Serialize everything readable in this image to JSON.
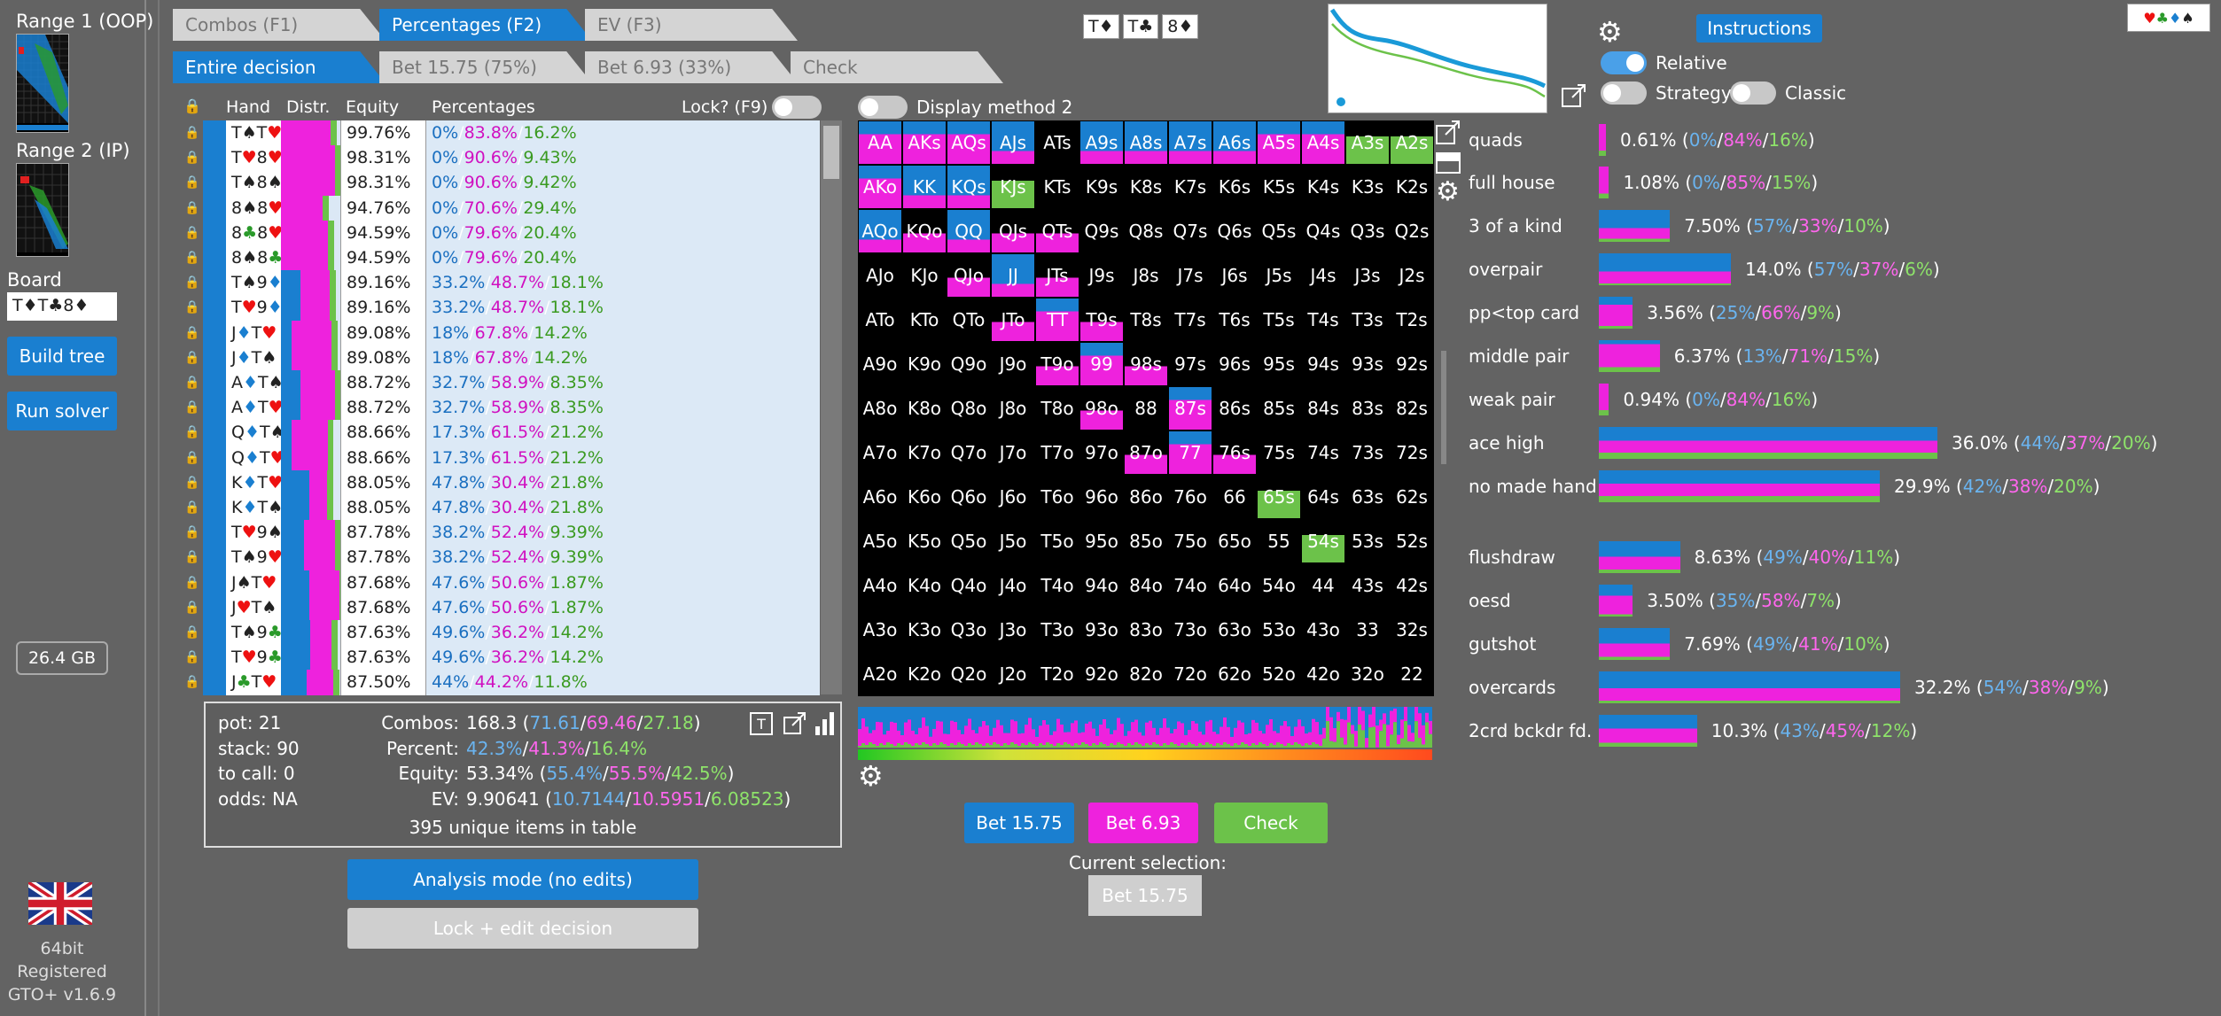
{
  "sidebar": {
    "range1_label": "Range 1 (OOP)",
    "range2_label": "Range 2 (IP)",
    "board_label": "Board",
    "board_value": "T♦T♣8♦",
    "build_tree": "Build tree",
    "run_solver": "Run solver",
    "memory": "26.4 GB",
    "bits": "64bit",
    "registered": "Registered",
    "version": "GTO+ v1.6.9"
  },
  "tabs_top": [
    "Combos (F1)",
    "Percentages (F2)",
    "EV (F3)"
  ],
  "tabs_decision": [
    "Entire decision",
    "Bet 15.75 (75%)",
    "Bet 6.93 (33%)",
    "Check"
  ],
  "board_cards": [
    "T♦",
    "T♣",
    "8♦"
  ],
  "table": {
    "headers": {
      "hand": "Hand",
      "distr": "Distr.",
      "equity": "Equity",
      "percentages": "Percentages",
      "lock": "Lock? (F9)"
    },
    "rows": [
      {
        "hand": "T♠T♥",
        "eq": "99.76%",
        "p": [
          "0%",
          "83.8%",
          "16.2%"
        ]
      },
      {
        "hand": "T♥8♥",
        "eq": "98.31%",
        "p": [
          "0%",
          "90.6%",
          "9.43%"
        ]
      },
      {
        "hand": "T♠8♠",
        "eq": "98.31%",
        "p": [
          "0%",
          "90.6%",
          "9.42%"
        ]
      },
      {
        "hand": "8♠8♥",
        "eq": "94.76%",
        "p": [
          "0%",
          "70.6%",
          "29.4%"
        ]
      },
      {
        "hand": "8♣8♥",
        "eq": "94.59%",
        "p": [
          "0%",
          "79.6%",
          "20.4%"
        ]
      },
      {
        "hand": "8♠8♣",
        "eq": "94.59%",
        "p": [
          "0%",
          "79.6%",
          "20.4%"
        ]
      },
      {
        "hand": "T♠9♦",
        "eq": "89.16%",
        "p": [
          "33.2%",
          "48.7%",
          "18.1%"
        ]
      },
      {
        "hand": "T♥9♦",
        "eq": "89.16%",
        "p": [
          "33.2%",
          "48.7%",
          "18.1%"
        ]
      },
      {
        "hand": "J♦T♥",
        "eq": "89.08%",
        "p": [
          "18%",
          "67.8%",
          "14.2%"
        ]
      },
      {
        "hand": "J♦T♠",
        "eq": "89.08%",
        "p": [
          "18%",
          "67.8%",
          "14.2%"
        ]
      },
      {
        "hand": "A♦T♠",
        "eq": "88.72%",
        "p": [
          "32.7%",
          "58.9%",
          "8.35%"
        ]
      },
      {
        "hand": "A♦T♥",
        "eq": "88.72%",
        "p": [
          "32.7%",
          "58.9%",
          "8.35%"
        ]
      },
      {
        "hand": "Q♦T♠",
        "eq": "88.66%",
        "p": [
          "17.3%",
          "61.5%",
          "21.2%"
        ]
      },
      {
        "hand": "Q♦T♥",
        "eq": "88.66%",
        "p": [
          "17.3%",
          "61.5%",
          "21.2%"
        ]
      },
      {
        "hand": "K♦T♥",
        "eq": "88.05%",
        "p": [
          "47.8%",
          "30.4%",
          "21.8%"
        ]
      },
      {
        "hand": "K♦T♠",
        "eq": "88.05%",
        "p": [
          "47.8%",
          "30.4%",
          "21.8%"
        ]
      },
      {
        "hand": "T♥9♠",
        "eq": "87.78%",
        "p": [
          "38.2%",
          "52.4%",
          "9.39%"
        ]
      },
      {
        "hand": "T♠9♥",
        "eq": "87.78%",
        "p": [
          "38.2%",
          "52.4%",
          "9.39%"
        ]
      },
      {
        "hand": "J♠T♥",
        "eq": "87.68%",
        "p": [
          "47.6%",
          "50.6%",
          "1.87%"
        ]
      },
      {
        "hand": "J♥T♠",
        "eq": "87.68%",
        "p": [
          "47.6%",
          "50.6%",
          "1.87%"
        ]
      },
      {
        "hand": "T♠9♣",
        "eq": "87.63%",
        "p": [
          "49.6%",
          "36.2%",
          "14.2%"
        ]
      },
      {
        "hand": "T♥9♣",
        "eq": "87.63%",
        "p": [
          "49.6%",
          "36.2%",
          "14.2%"
        ]
      },
      {
        "hand": "J♣T♥",
        "eq": "87.50%",
        "p": [
          "44%",
          "44.2%",
          "11.8%"
        ]
      }
    ]
  },
  "info": {
    "pot": "pot: 21",
    "stack": "stack: 90",
    "tocall": "to call: 0",
    "odds": "odds: NA",
    "combos_label": "Combos:",
    "combos_total": "168.3",
    "combos_parts": [
      "71.61",
      "69.46",
      "27.18"
    ],
    "percent_label": "Percent:",
    "percent_parts": [
      "42.3%",
      "41.3%",
      "16.4%"
    ],
    "equity_label": "Equity:",
    "equity_total": "53.34%",
    "equity_parts": [
      "55.4%",
      "55.5%",
      "42.5%"
    ],
    "ev_label": "EV:",
    "ev_total": "9.90641",
    "ev_parts": [
      "10.7144",
      "10.5951",
      "6.08523"
    ],
    "unique": "395 unique items in table"
  },
  "buttons": {
    "analysis": "Analysis mode (no edits)",
    "lock_edit": "Lock + edit decision",
    "bet1": "Bet 15.75",
    "bet2": "Bet 6.93",
    "check": "Check",
    "current_selection": "Current selection:",
    "current_value": "Bet 15.75",
    "instructions": "Instructions"
  },
  "display_method": "Display method 2",
  "toggles": {
    "relative": "Relative",
    "strategy": "Strategy",
    "classic": "Classic"
  },
  "grid": [
    [
      "AA",
      "AKs",
      "AQs",
      "AJs",
      "ATs",
      "A9s",
      "A8s",
      "A7s",
      "A6s",
      "A5s",
      "A4s",
      "A3s",
      "A2s"
    ],
    [
      "AKo",
      "KK",
      "KQs",
      "KJs",
      "KTs",
      "K9s",
      "K8s",
      "K7s",
      "K6s",
      "K5s",
      "K4s",
      "K3s",
      "K2s"
    ],
    [
      "AQo",
      "KQo",
      "QQ",
      "QJs",
      "QTs",
      "Q9s",
      "Q8s",
      "Q7s",
      "Q6s",
      "Q5s",
      "Q4s",
      "Q3s",
      "Q2s"
    ],
    [
      "AJo",
      "KJo",
      "QJo",
      "JJ",
      "JTs",
      "J9s",
      "J8s",
      "J7s",
      "J6s",
      "J5s",
      "J4s",
      "J3s",
      "J2s"
    ],
    [
      "ATo",
      "KTo",
      "QTo",
      "JTo",
      "TT",
      "T9s",
      "T8s",
      "T7s",
      "T6s",
      "T5s",
      "T4s",
      "T3s",
      "T2s"
    ],
    [
      "A9o",
      "K9o",
      "Q9o",
      "J9o",
      "T9o",
      "99",
      "98s",
      "97s",
      "96s",
      "95s",
      "94s",
      "93s",
      "92s"
    ],
    [
      "A8o",
      "K8o",
      "Q8o",
      "J8o",
      "T8o",
      "98o",
      "88",
      "87s",
      "86s",
      "85s",
      "84s",
      "83s",
      "82s"
    ],
    [
      "A7o",
      "K7o",
      "Q7o",
      "J7o",
      "T7o",
      "97o",
      "87o",
      "77",
      "76s",
      "75s",
      "74s",
      "73s",
      "72s"
    ],
    [
      "A6o",
      "K6o",
      "Q6o",
      "J6o",
      "T6o",
      "96o",
      "86o",
      "76o",
      "66",
      "65s",
      "64s",
      "63s",
      "62s"
    ],
    [
      "A5o",
      "K5o",
      "Q5o",
      "J5o",
      "T5o",
      "95o",
      "85o",
      "75o",
      "65o",
      "55",
      "54s",
      "53s",
      "52s"
    ],
    [
      "A4o",
      "K4o",
      "Q4o",
      "J4o",
      "T4o",
      "94o",
      "84o",
      "74o",
      "64o",
      "54o",
      "44",
      "43s",
      "42s"
    ],
    [
      "A3o",
      "K3o",
      "Q3o",
      "J3o",
      "T3o",
      "93o",
      "83o",
      "73o",
      "63o",
      "53o",
      "43o",
      "33",
      "32s"
    ],
    [
      "A2o",
      "K2o",
      "Q2o",
      "J2o",
      "T2o",
      "92o",
      "82o",
      "72o",
      "62o",
      "52o",
      "42o",
      "32o",
      "22"
    ]
  ],
  "categories": [
    {
      "name": "quads",
      "total": "0.61%",
      "parts": [
        "0%",
        "84%",
        "16%"
      ],
      "freq": 0.02
    },
    {
      "name": "full house",
      "total": "1.08%",
      "parts": [
        "0%",
        "85%",
        "15%"
      ],
      "freq": 0.03
    },
    {
      "name": "3 of a kind",
      "total": "7.50%",
      "parts": [
        "57%",
        "33%",
        "10%"
      ],
      "freq": 0.21
    },
    {
      "name": "overpair",
      "total": "14.0%",
      "parts": [
        "57%",
        "37%",
        "6%"
      ],
      "freq": 0.39
    },
    {
      "name": "pp<top card",
      "total": "3.56%",
      "parts": [
        "25%",
        "66%",
        "9%"
      ],
      "freq": 0.1
    },
    {
      "name": "middle pair",
      "total": "6.37%",
      "parts": [
        "13%",
        "71%",
        "15%"
      ],
      "freq": 0.18
    },
    {
      "name": "weak pair",
      "total": "0.94%",
      "parts": [
        "0%",
        "84%",
        "16%"
      ],
      "freq": 0.03
    },
    {
      "name": "ace high",
      "total": "36.0%",
      "parts": [
        "44%",
        "37%",
        "20%"
      ],
      "freq": 1.0
    },
    {
      "name": "no made hand",
      "total": "29.9%",
      "parts": [
        "42%",
        "38%",
        "20%"
      ],
      "freq": 0.83
    },
    {
      "name": "flushdraw",
      "total": "8.63%",
      "parts": [
        "49%",
        "40%",
        "11%"
      ],
      "freq": 0.24
    },
    {
      "name": "oesd",
      "total": "3.50%",
      "parts": [
        "35%",
        "58%",
        "7%"
      ],
      "freq": 0.1
    },
    {
      "name": "gutshot",
      "total": "7.69%",
      "parts": [
        "49%",
        "41%",
        "10%"
      ],
      "freq": 0.21
    },
    {
      "name": "overcards",
      "total": "32.2%",
      "parts": [
        "54%",
        "38%",
        "9%"
      ],
      "freq": 0.89
    },
    {
      "name": "2crd bckdr fd.",
      "total": "10.3%",
      "parts": [
        "43%",
        "45%",
        "12%"
      ],
      "freq": 0.29
    }
  ],
  "colors": {
    "bet_big": "#1a7fd0",
    "bet_small": "#ee22dd",
    "check": "#6cc24a",
    "bg": "#636363"
  }
}
